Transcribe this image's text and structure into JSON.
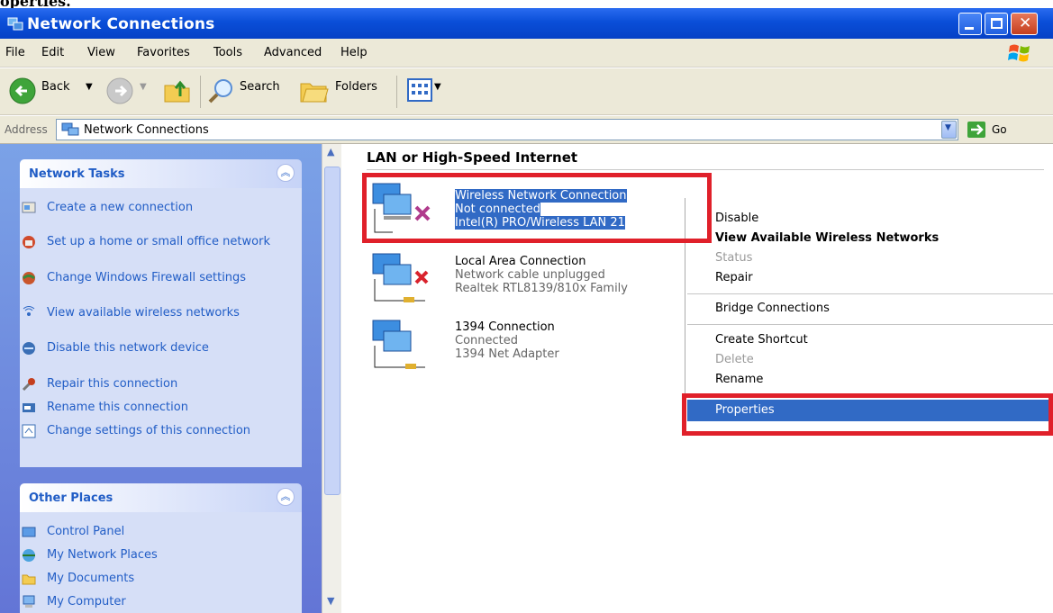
{
  "caption": "operties.",
  "window": {
    "title": "Network Connections"
  },
  "menu": [
    "File",
    "Edit",
    "View",
    "Favorites",
    "Tools",
    "Advanced",
    "Help"
  ],
  "toolbar": {
    "back": "Back",
    "search": "Search",
    "folders": "Folders"
  },
  "address": {
    "label": "Address",
    "value": "Network Connections",
    "go": "Go"
  },
  "sidebar": {
    "network_tasks": {
      "title": "Network Tasks",
      "items": [
        {
          "label": "Create a new connection",
          "icon": "new-connection-icon"
        },
        {
          "label": "Set up a home or small office network",
          "icon": "home-network-icon"
        },
        {
          "label": "Change Windows Firewall settings",
          "icon": "firewall-icon"
        },
        {
          "label": "View available wireless networks",
          "icon": "wireless-icon"
        },
        {
          "label": "Disable this network device",
          "icon": "disable-network-icon"
        },
        {
          "label": "Repair this connection",
          "icon": "repair-icon"
        },
        {
          "label": "Rename this connection",
          "icon": "rename-icon"
        },
        {
          "label": "Change settings of this connection",
          "icon": "settings-icon"
        }
      ]
    },
    "other_places": {
      "title": "Other Places",
      "items": [
        {
          "label": "Control Panel",
          "icon": "control-panel-icon"
        },
        {
          "label": "My Network Places",
          "icon": "network-places-icon"
        },
        {
          "label": "My Documents",
          "icon": "documents-icon"
        },
        {
          "label": "My Computer",
          "icon": "computer-icon"
        }
      ]
    }
  },
  "main": {
    "group_title": "LAN or High-Speed Internet",
    "connections": [
      {
        "name": "Wireless Network Connection",
        "status": "Not connected",
        "device": "Intel(R) PRO/Wireless LAN 21"
      },
      {
        "name": "Local Area Connection",
        "status": "Network cable unplugged",
        "device": "Realtek RTL8139/810x Family"
      },
      {
        "name": "1394 Connection",
        "status": "Connected",
        "device": "1394 Net Adapter"
      }
    ]
  },
  "context_menu": {
    "items": [
      {
        "label": "Disable"
      },
      {
        "label": "View Available Wireless Networks"
      },
      {
        "label": "Status"
      },
      {
        "label": "Repair"
      },
      {
        "label": "Bridge Connections"
      },
      {
        "label": "Create Shortcut"
      },
      {
        "label": "Delete"
      },
      {
        "label": "Rename"
      },
      {
        "label": "Properties"
      }
    ]
  },
  "colors": {
    "highlight": "#316ac5",
    "annotation": "#e0202a",
    "title_blue": "#0a4ed8"
  }
}
